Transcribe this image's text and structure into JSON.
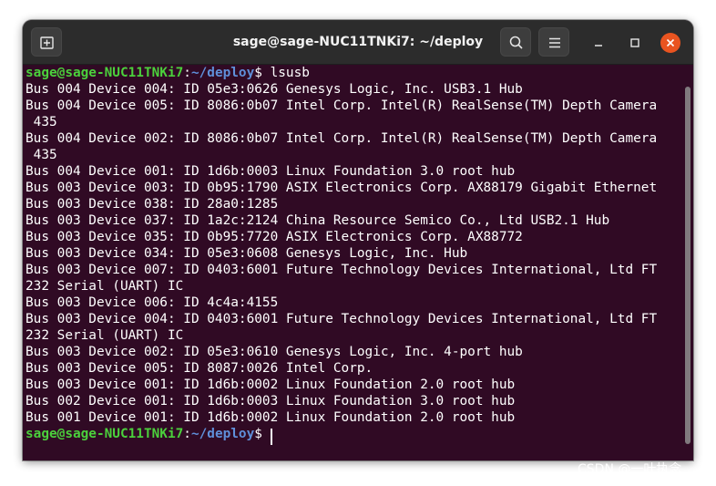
{
  "window": {
    "title": "sage@sage-NUC11TNKi7: ~/deploy"
  },
  "titlebar": {
    "new_tab_icon": "new-tab-icon",
    "search_icon": "search-icon",
    "menu_icon": "hamburger-menu-icon",
    "minimize_icon": "minimize-icon",
    "maximize_icon": "maximize-icon",
    "close_icon": "close-icon"
  },
  "colors": {
    "terminal_bg": "#300a24",
    "prompt_user": "#4bd03c",
    "prompt_path": "#5f8fd9",
    "close_button": "#e95420"
  },
  "terminal": {
    "prompt": {
      "user_host": "sage@sage-NUC11TNKi7",
      "separator": ":",
      "path": "~/deploy",
      "symbol": "$ "
    },
    "command": "lsusb",
    "output": [
      "Bus 004 Device 004: ID 05e3:0626 Genesys Logic, Inc. USB3.1 Hub",
      "Bus 004 Device 005: ID 8086:0b07 Intel Corp. Intel(R) RealSense(TM) Depth Camera",
      " 435",
      "Bus 004 Device 002: ID 8086:0b07 Intel Corp. Intel(R) RealSense(TM) Depth Camera",
      " 435",
      "Bus 004 Device 001: ID 1d6b:0003 Linux Foundation 3.0 root hub",
      "Bus 003 Device 003: ID 0b95:1790 ASIX Electronics Corp. AX88179 Gigabit Ethernet",
      "Bus 003 Device 038: ID 28a0:1285",
      "Bus 003 Device 037: ID 1a2c:2124 China Resource Semico Co., Ltd USB2.1 Hub",
      "Bus 003 Device 035: ID 0b95:7720 ASIX Electronics Corp. AX88772",
      "Bus 003 Device 034: ID 05e3:0608 Genesys Logic, Inc. Hub",
      "Bus 003 Device 007: ID 0403:6001 Future Technology Devices International, Ltd FT",
      "232 Serial (UART) IC",
      "Bus 003 Device 006: ID 4c4a:4155",
      "Bus 003 Device 004: ID 0403:6001 Future Technology Devices International, Ltd FT",
      "232 Serial (UART) IC",
      "Bus 003 Device 002: ID 05e3:0610 Genesys Logic, Inc. 4-port hub",
      "Bus 003 Device 005: ID 8087:0026 Intel Corp.",
      "Bus 003 Device 001: ID 1d6b:0002 Linux Foundation 2.0 root hub",
      "Bus 002 Device 001: ID 1d6b:0003 Linux Foundation 3.0 root hub",
      "Bus 001 Device 001: ID 1d6b:0002 Linux Foundation 2.0 root hub"
    ]
  },
  "watermark": "CSDN @一叶执念"
}
